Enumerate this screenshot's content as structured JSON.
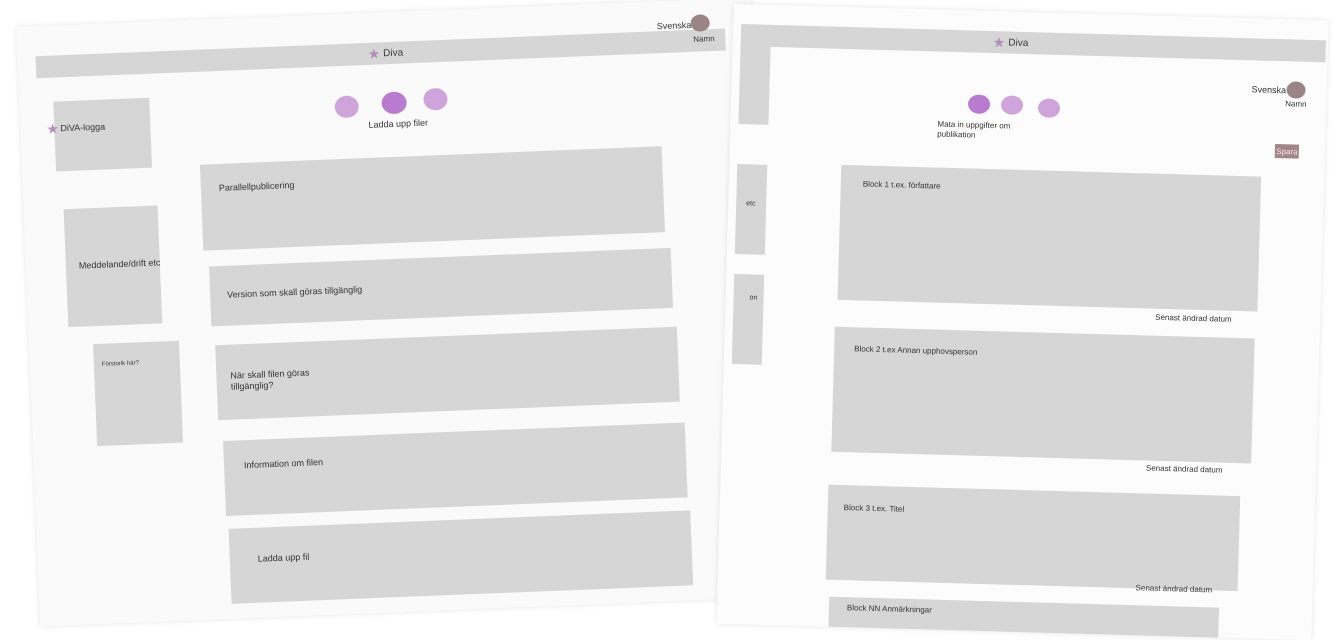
{
  "left_page": {
    "brand": "Diva",
    "language": "Svenska",
    "user_name": "Namn",
    "logo_label": "DiVA-logga",
    "notice_label": "Meddelande/drift etc",
    "small_box_label": "Förstorik här?",
    "stepper": {
      "active_step_label": "Ladda upp filer"
    },
    "sections": [
      {
        "label": "Parallellpublicering"
      },
      {
        "label": "Version som skall göras tillgänglig"
      },
      {
        "label": "När skall filen göras tillgänglig?"
      },
      {
        "label": "Information om filen"
      },
      {
        "label": "Ladda upp fil"
      }
    ]
  },
  "right_page": {
    "brand": "Diva",
    "language": "Svenska",
    "user_name": "Namn",
    "save_label": "Spara",
    "stepper": {
      "active_step_label": "Mata in uppgifter om publikation"
    },
    "blocks": [
      {
        "label": "Block 1 t.ex. författare",
        "date": "Senast ändrad  datum"
      },
      {
        "label": "Block 2 t.ex Annan upphovsperson",
        "date": "Senast ändrad datum"
      },
      {
        "label": "Block 3 t.ex. Titel",
        "date": "Senast ändrad datum"
      },
      {
        "label": "Block NN Anmärkningar"
      }
    ],
    "peek_labels": [
      "etc",
      "on"
    ]
  },
  "colors": {
    "placeholder_gray": "#d6d6d6",
    "step_active": "#b87bcf",
    "step_idle": "#cfa4da",
    "avatar": "#9a8584",
    "save_button": "#a48589",
    "star": "#b48fb8"
  }
}
